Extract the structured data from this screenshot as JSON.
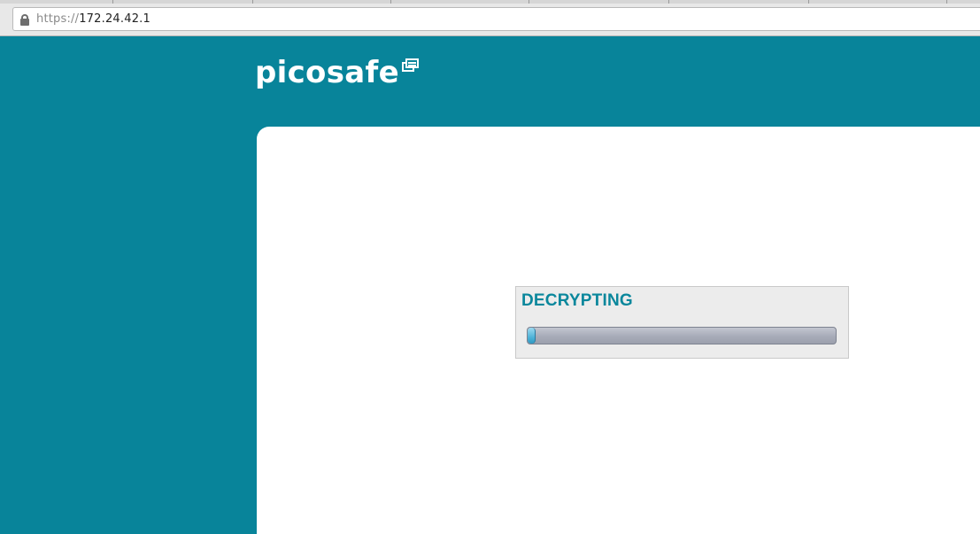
{
  "browser": {
    "url_scheme": "https://",
    "url_host": "172.24.42.1",
    "lock_icon": "lock-icon"
  },
  "header": {
    "brand": "picosafe",
    "brand_icon": "picosafe-logo-icon",
    "background_color": "#08849a"
  },
  "progress": {
    "title": "DECRYPTING",
    "value_fraction": 0.01,
    "title_color": "#0a879c"
  }
}
